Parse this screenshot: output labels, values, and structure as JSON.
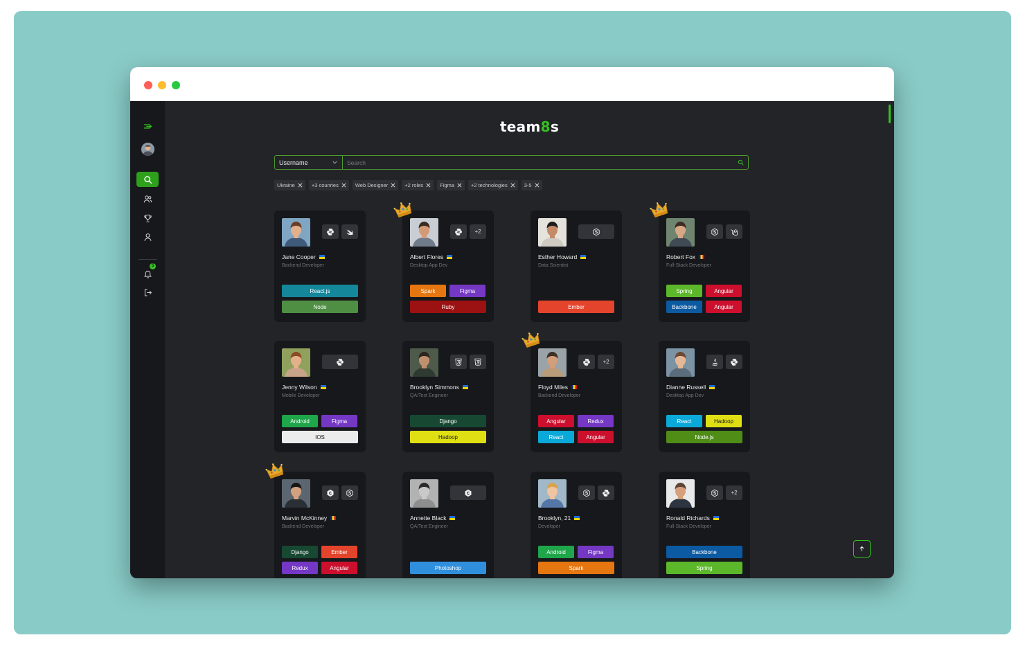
{
  "app": {
    "logo_text": "team",
    "logo_accent": "8",
    "logo_suffix": "s"
  },
  "colors": {
    "accent": "#2ea01c",
    "background": "#222428",
    "sidebar": "#17181b",
    "card": "#17181b",
    "backdrop": "#89cbc7"
  },
  "sidebar": {
    "items": [
      {
        "name": "menu-toggle",
        "icon": "menu-arrow-icon"
      },
      {
        "name": "profile-avatar",
        "icon": "avatar"
      },
      {
        "name": "search",
        "icon": "search-icon",
        "active": true
      },
      {
        "name": "teams",
        "icon": "users-icon"
      },
      {
        "name": "achievements",
        "icon": "trophy-icon"
      },
      {
        "name": "profile",
        "icon": "user-icon"
      },
      {
        "name": "notifications",
        "icon": "bell-icon"
      },
      {
        "name": "logout",
        "icon": "logout-icon"
      }
    ]
  },
  "search": {
    "select_value": "Username",
    "placeholder": "Search",
    "value": ""
  },
  "filters": [
    {
      "label": "Ukraine"
    },
    {
      "label": "+3 counries"
    },
    {
      "label": "Web Designer"
    },
    {
      "label": "+2 roles"
    },
    {
      "label": "Figma"
    },
    {
      "label": "+2 technologies"
    },
    {
      "label": "3-5"
    }
  ],
  "cards": [
    {
      "name": "Jane Cooper",
      "flag": "ua",
      "role": "Backend Developer",
      "crown": false,
      "tech": [
        "python-icon",
        "swift-icon"
      ],
      "extra": "",
      "skills": [
        {
          "label": "React.js",
          "color": "#14879b",
          "w": "full"
        },
        {
          "label": "Node",
          "color": "#4e8f44",
          "w": "full"
        }
      ]
    },
    {
      "name": "Albert Flores",
      "flag": "ua",
      "role": "Desktop App Dev",
      "crown": true,
      "tech": [
        "python-icon"
      ],
      "extra": "+2",
      "skills": [
        {
          "label": "Spark",
          "color": "#e6760f",
          "w": "half"
        },
        {
          "label": "Figma",
          "color": "#7438c4",
          "w": "half"
        },
        {
          "label": "Ruby",
          "color": "#9c1111",
          "w": "full"
        }
      ]
    },
    {
      "name": "Esther Howard",
      "flag": "ua",
      "role": "Data Scientist",
      "crown": false,
      "tech": [
        "nodejs-icon"
      ],
      "extra": "",
      "wide": true,
      "skills": [
        {
          "label": "Ember",
          "color": "#e5442c",
          "w": "full"
        }
      ]
    },
    {
      "name": "Robert Fox",
      "flag": "ro",
      "role": "Full-Stack Developer",
      "crown": true,
      "tech": [
        "nodejs-icon",
        "laravel-icon"
      ],
      "extra": "",
      "skills": [
        {
          "label": "Spring",
          "color": "#5cb82a",
          "w": "half"
        },
        {
          "label": "Angular",
          "color": "#cc0f2d",
          "w": "half"
        },
        {
          "label": "Backbone",
          "color": "#0b5aa2",
          "w": "half"
        },
        {
          "label": "Angular",
          "color": "#cc0f2d",
          "w": "half"
        }
      ]
    },
    {
      "name": "Jenny Wilson",
      "flag": "ua",
      "role": "Mobile Developer",
      "crown": false,
      "tech": [
        "python-icon"
      ],
      "extra": "",
      "wide": true,
      "skills": [
        {
          "label": "Android",
          "color": "#1fa54a",
          "w": "half"
        },
        {
          "label": "Figma",
          "color": "#7438c4",
          "w": "half"
        },
        {
          "label": "IOS",
          "color": "#ececec",
          "w": "full",
          "dark": true
        }
      ]
    },
    {
      "name": "Brooklyn Simmons",
      "flag": "ua",
      "role": "QA/Test Engineer",
      "crown": false,
      "tech": [
        "html5-icon",
        "html5-icon"
      ],
      "extra": "",
      "skills": [
        {
          "label": "Django",
          "color": "#164832",
          "w": "full"
        },
        {
          "label": "Hadoop",
          "color": "#e0df14",
          "w": "full",
          "dark": true
        }
      ]
    },
    {
      "name": "Floyd Miles",
      "flag": "ro",
      "role": "Backend Developer",
      "crown": true,
      "tech": [
        "python-icon"
      ],
      "extra": "+2",
      "skills": [
        {
          "label": "Angular",
          "color": "#cc0f2d",
          "w": "half"
        },
        {
          "label": "Redux",
          "color": "#7438c4",
          "w": "half"
        },
        {
          "label": "React",
          "color": "#0aa9d9",
          "w": "half"
        },
        {
          "label": "Angular",
          "color": "#cc0f2d",
          "w": "half"
        }
      ]
    },
    {
      "name": "Dianne Russell",
      "flag": "ua",
      "role": "Desktop App Dev",
      "crown": false,
      "tech": [
        "java-icon",
        "python-icon"
      ],
      "extra": "",
      "skills": [
        {
          "label": "React",
          "color": "#0aa9d9",
          "w": "half"
        },
        {
          "label": "Hadoop",
          "color": "#e0df14",
          "w": "half",
          "dark": true
        },
        {
          "label": "Node.js",
          "color": "#4f8d17",
          "w": "full"
        }
      ]
    },
    {
      "name": "Marvin McKinney",
      "flag": "ro",
      "role": "Backend Developer",
      "crown": true,
      "tech": [
        "csharp-icon",
        "nodejs-icon"
      ],
      "extra": "",
      "skills": [
        {
          "label": "Django",
          "color": "#164832",
          "w": "half"
        },
        {
          "label": "Ember",
          "color": "#e5442c",
          "w": "half"
        },
        {
          "label": "Redux",
          "color": "#7438c4",
          "w": "half"
        },
        {
          "label": "Angular",
          "color": "#cc0f2d",
          "w": "half"
        }
      ]
    },
    {
      "name": "Annette Black",
      "flag": "ua",
      "role": "QA/Test Engineer",
      "crown": false,
      "tech": [
        "csharp-icon"
      ],
      "extra": "",
      "wide": true,
      "skills": [
        {
          "label": "Photoshop",
          "color": "#2f8fdd",
          "w": "full"
        }
      ]
    },
    {
      "name": "Brooklyn, 21",
      "flag": "ua",
      "role": "Developer",
      "crown": false,
      "tech": [
        "nodejs-icon",
        "python-icon"
      ],
      "extra": "",
      "skills": [
        {
          "label": "Android",
          "color": "#1fa54a",
          "w": "half"
        },
        {
          "label": "Figma",
          "color": "#7438c4",
          "w": "half"
        },
        {
          "label": "Spark",
          "color": "#e6760f",
          "w": "full"
        }
      ]
    },
    {
      "name": "Ronald Richards",
      "flag": "ua",
      "role": "Full-Stack Developer",
      "crown": false,
      "tech": [
        "nodejs-icon"
      ],
      "extra": "+2",
      "skills": [
        {
          "label": "Backbone",
          "color": "#0b5aa2",
          "w": "full"
        },
        {
          "label": "Spring",
          "color": "#5cb82a",
          "w": "full"
        }
      ]
    }
  ]
}
